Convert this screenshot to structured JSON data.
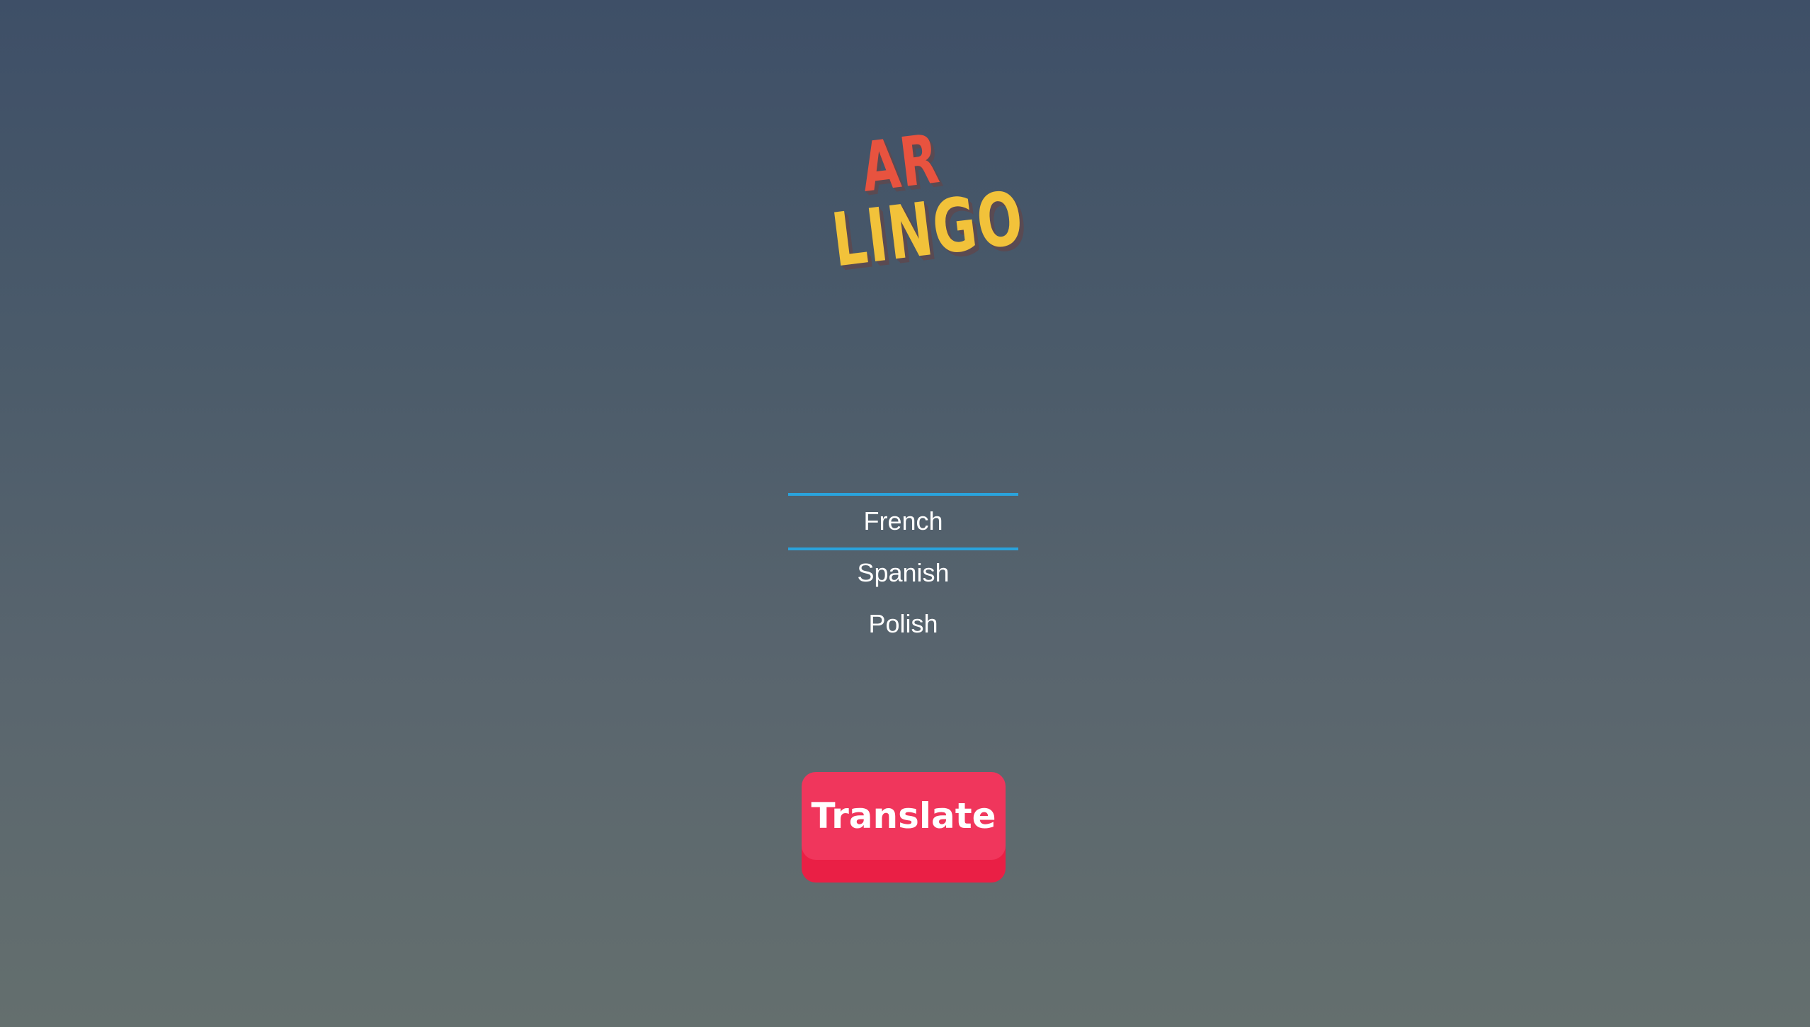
{
  "logo": {
    "line1": "AR",
    "line2": "LINGO",
    "line1_color": "#e8533f",
    "line2_color": "#f2c23a",
    "shadow_color": "#5a4a52"
  },
  "language_picker": {
    "selected": "French",
    "options": [
      "French",
      "Spanish",
      "Polish"
    ],
    "selection_line_color": "#2aa3dc"
  },
  "translate_button": {
    "label": "Translate",
    "color": "#f0365c"
  }
}
